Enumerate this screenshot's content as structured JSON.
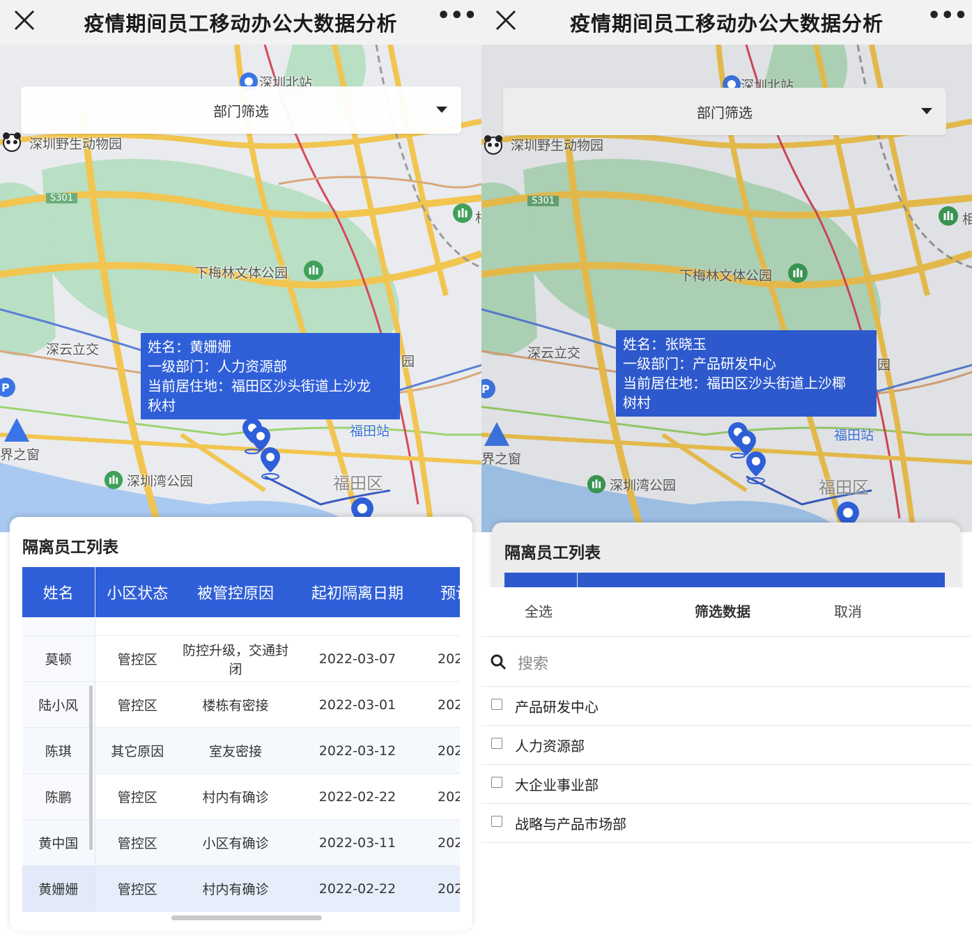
{
  "app": {
    "title": "疫情期间员工移动办公大数据分析"
  },
  "map": {
    "labels": {
      "north_station": "深圳北站",
      "zoo": "深圳野生动物园",
      "road_s301": "S301",
      "park_meilin": "下梅林文体公园",
      "shenyun": "深云立交",
      "futian_station": "福田站",
      "futian_district": "福田区",
      "bay_park": "深圳湾公园",
      "window": "界之窗",
      "park_char": "相",
      "park_suffix": "园",
      "parking": "P"
    },
    "filter_label": "部门筛选"
  },
  "left": {
    "tooltip": {
      "line1": "姓名：黄姗姗",
      "line2": "一级部门：人力资源部",
      "line3": "当前居住地：福田区沙头街道上沙龙",
      "line4": "秋村"
    },
    "panel": {
      "title": "隔离员工列表",
      "columns": [
        "姓名",
        "小区状态",
        "被管控原因",
        "起初隔离日期",
        "预计"
      ],
      "rows": [
        {
          "name": "莫顿",
          "status": "管控区",
          "reason1": "防控升级，交通封",
          "reason2": "闭",
          "date": "2022-03-07",
          "next": "202"
        },
        {
          "name": "陆小风",
          "status": "管控区",
          "reason1": "楼栋有密接",
          "reason2": "",
          "date": "2022-03-01",
          "next": "202"
        },
        {
          "name": "陈琪",
          "status": "其它原因",
          "reason1": "室友密接",
          "reason2": "",
          "date": "2022-03-12",
          "next": "202"
        },
        {
          "name": "陈鹏",
          "status": "管控区",
          "reason1": "村内有确诊",
          "reason2": "",
          "date": "2022-02-22",
          "next": "202"
        },
        {
          "name": "黄中国",
          "status": "管控区",
          "reason1": "小区有确诊",
          "reason2": "",
          "date": "2022-03-11",
          "next": "202"
        },
        {
          "name": "黄姗姗",
          "status": "管控区",
          "reason1": "村内有确诊",
          "reason2": "",
          "date": "2022-02-22",
          "next": "202"
        }
      ]
    }
  },
  "right": {
    "tooltip": {
      "line1": "姓名：张晓玉",
      "line2": "一级部门：产品研发中心",
      "line3": "当前居住地：福田区沙头街道上沙椰",
      "line4": "树村"
    },
    "panel_title": "隔离员工列表",
    "sheet": {
      "select_all": "全选",
      "filter": "筛选数据",
      "cancel": "取消",
      "search_placeholder": "搜索",
      "options": [
        "产品研发中心",
        "人力资源部",
        "大企业事业部",
        "战略与产品市场部"
      ]
    }
  },
  "colors": {
    "accent_blue": "#2f5fd8",
    "map_green": "#b9dfc4",
    "map_road_yellow": "#f2c550",
    "map_water": "#a9c9f0"
  }
}
